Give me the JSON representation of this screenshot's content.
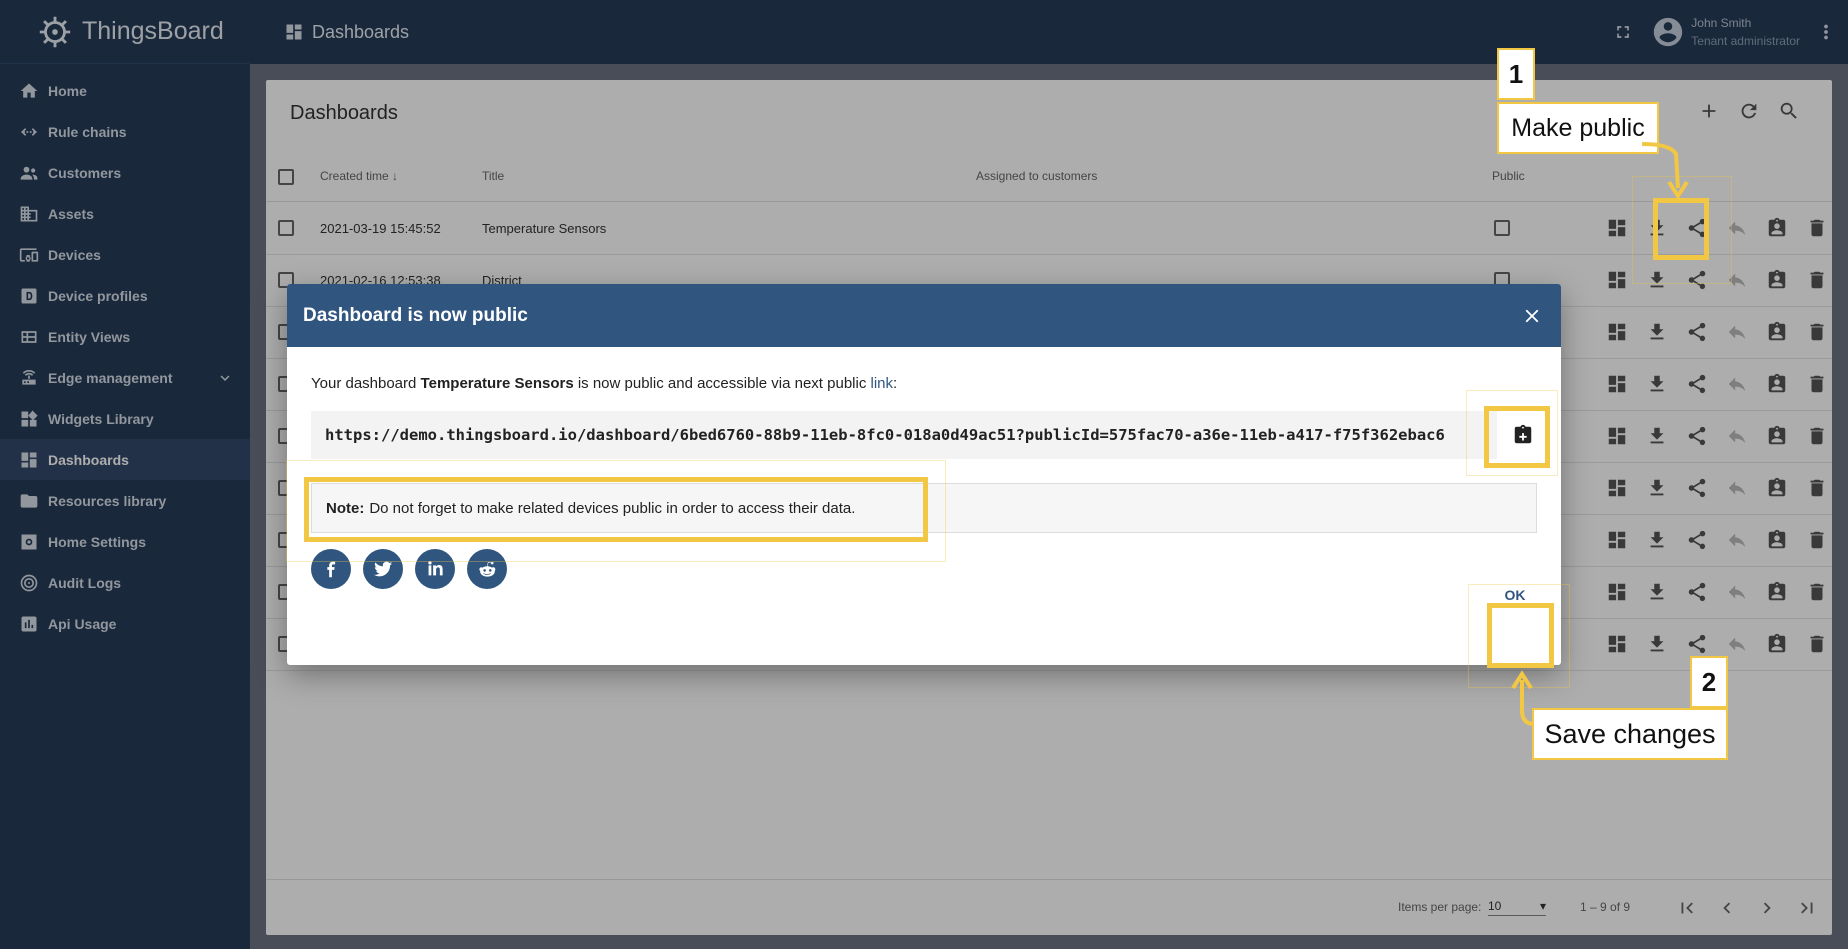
{
  "app": {
    "name": "ThingsBoard"
  },
  "sidebar": {
    "items": [
      {
        "label": "Home",
        "icon": "home-icon"
      },
      {
        "label": "Rule chains",
        "icon": "rule-chains-icon"
      },
      {
        "label": "Customers",
        "icon": "customers-icon"
      },
      {
        "label": "Assets",
        "icon": "assets-icon"
      },
      {
        "label": "Devices",
        "icon": "devices-icon"
      },
      {
        "label": "Device profiles",
        "icon": "device-profiles-icon"
      },
      {
        "label": "Entity Views",
        "icon": "entity-views-icon"
      },
      {
        "label": "Edge management",
        "icon": "edge-management-icon",
        "expandable": true
      },
      {
        "label": "Widgets Library",
        "icon": "widgets-library-icon"
      },
      {
        "label": "Dashboards",
        "icon": "dashboards-icon",
        "active": true
      },
      {
        "label": "Resources library",
        "icon": "folder-icon"
      },
      {
        "label": "Home Settings",
        "icon": "settings-icon"
      },
      {
        "label": "Audit Logs",
        "icon": "audit-logs-icon"
      },
      {
        "label": "Api Usage",
        "icon": "api-usage-icon"
      }
    ]
  },
  "topbar": {
    "title": "Dashboards",
    "user_name": "John Smith",
    "user_role": "Tenant administrator"
  },
  "card": {
    "title": "Dashboards",
    "columns": {
      "created": "Created time",
      "title": "Title",
      "assigned": "Assigned to customers",
      "public": "Public"
    },
    "rows": [
      {
        "created": "2021-03-19 15:45:52",
        "title": "Temperature Sensors"
      },
      {
        "created": "2021-02-16 12:53:38",
        "title": "District"
      },
      {
        "created": "",
        "title": ""
      },
      {
        "created": "",
        "title": ""
      },
      {
        "created": "",
        "title": ""
      },
      {
        "created": "",
        "title": ""
      },
      {
        "created": "",
        "title": ""
      },
      {
        "created": "",
        "title": ""
      },
      {
        "created": "",
        "title": ""
      }
    ],
    "paginator": {
      "label": "Items per page:",
      "page_size": "10",
      "range": "1 – 9 of 9"
    }
  },
  "dialog": {
    "title": "Dashboard is now public",
    "msg_prefix": "Your dashboard ",
    "dashboard_name": "Temperature Sensors",
    "msg_suffix": " is now public and accessible via next public ",
    "link_text": "link",
    "msg_end": ":",
    "url": "https://demo.thingsboard.io/dashboard/6bed6760-88b9-11eb-8fc0-018a0d49ac51?publicId=575fac70-a36e-11eb-a417-f75f362ebac6",
    "note_label": "Note:",
    "note_text": "Do not forget to make related devices public in order to access their data.",
    "ok_label": "OK"
  },
  "annotations": {
    "step1_number": "1",
    "step1_label": "Make public",
    "step2_number": "2",
    "step2_label": "Save changes",
    "highlight_color": "#f2c744"
  },
  "colors": {
    "sidebar": "#263b58",
    "dialog_header": "#305680",
    "accent": "#305680"
  }
}
